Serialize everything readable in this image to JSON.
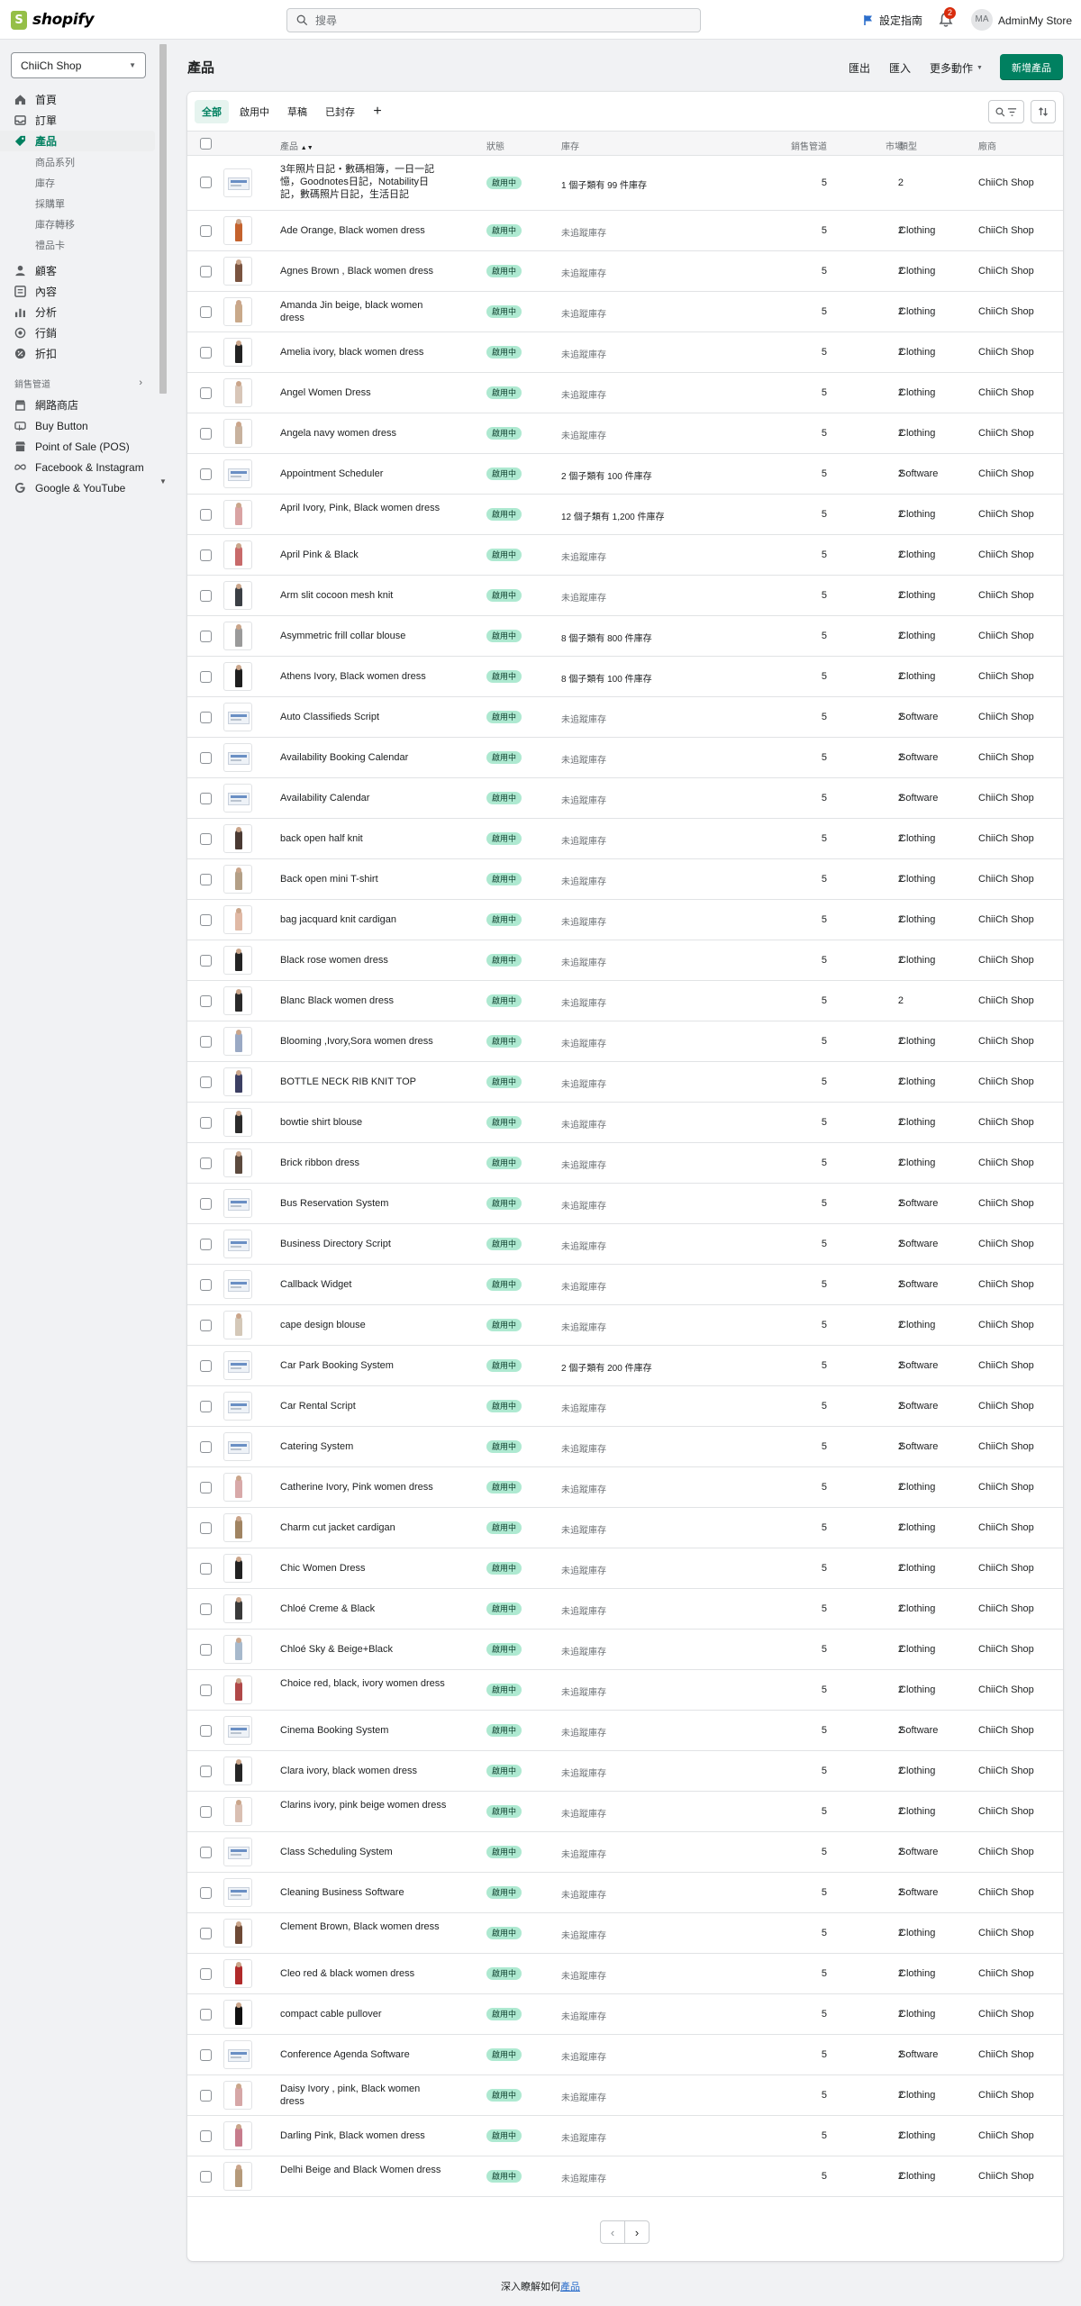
{
  "topbar": {
    "logo_text": "shopify",
    "search_placeholder": "搜尋",
    "setup_guide": "設定指南",
    "notifications_count": "2",
    "avatar_initials": "MA",
    "store_account": "AdminMy Store"
  },
  "sidebar": {
    "store_select": "ChiiCh Shop",
    "items": [
      {
        "label": "首頁",
        "icon": "home-icon"
      },
      {
        "label": "訂單",
        "icon": "orders-icon"
      },
      {
        "label": "產品",
        "icon": "tag-icon",
        "active": true
      }
    ],
    "product_subitems": [
      "商品系列",
      "庫存",
      "採購單",
      "庫存轉移",
      "禮品卡"
    ],
    "items2": [
      {
        "label": "顧客",
        "icon": "person-icon"
      },
      {
        "label": "內容",
        "icon": "content-icon"
      },
      {
        "label": "分析",
        "icon": "chart-icon"
      },
      {
        "label": "行銷",
        "icon": "target-icon"
      },
      {
        "label": "折扣",
        "icon": "discount-icon"
      }
    ],
    "channels_header": "銷售管道",
    "channels": [
      {
        "label": "網路商店",
        "icon": "store-icon"
      },
      {
        "label": "Buy Button",
        "icon": "button-icon"
      },
      {
        "label": "Point of Sale (POS)",
        "icon": "pos-icon"
      },
      {
        "label": "Facebook & Instagram",
        "icon": "meta-icon"
      },
      {
        "label": "Google & YouTube",
        "icon": "google-icon"
      }
    ]
  },
  "page": {
    "title": "產品",
    "export": "匯出",
    "import": "匯入",
    "more_actions": "更多動作",
    "add_product": "新增產品"
  },
  "tabs": [
    "全部",
    "啟用中",
    "草稿",
    "已封存"
  ],
  "table": {
    "headers": {
      "product": "產品",
      "status": "狀態",
      "inventory": "庫存",
      "sales_channels": "銷售管道",
      "markets": "市場",
      "type": "類型",
      "vendor": "廠商"
    },
    "status_label": "啟用中",
    "rows": [
      {
        "name": "3年照片日記・數碼相簿，一日一記憶，Goodnotes日記，Notability日記，數碼照片日記，生活日記",
        "inventory": "1 個子類有 99 件庫存",
        "channels": "5",
        "markets": "2",
        "type": "",
        "vendor": "ChiiCh Shop",
        "thumb": "doc",
        "lines": 3
      },
      {
        "name": "Ade Orange, Black women dress",
        "inventory": "未追蹤庫存",
        "channels": "5",
        "markets": "2",
        "type": "Clothing",
        "vendor": "ChiiCh Shop",
        "thumb": "#c4622d"
      },
      {
        "name": "Agnes Brown , Black women dress",
        "inventory": "未追蹤庫存",
        "channels": "5",
        "markets": "2",
        "type": "Clothing",
        "vendor": "ChiiCh Shop",
        "thumb": "#7a5440"
      },
      {
        "name": "Amanda Jin beige, black women dress",
        "inventory": "未追蹤庫存",
        "channels": "5",
        "markets": "2",
        "type": "Clothing",
        "vendor": "ChiiCh Shop",
        "thumb": "#c9a98a",
        "lines": 2
      },
      {
        "name": "Amelia ivory, black women dress",
        "inventory": "未追蹤庫存",
        "channels": "5",
        "markets": "2",
        "type": "Clothing",
        "vendor": "ChiiCh Shop",
        "thumb": "#222222"
      },
      {
        "name": "Angel Women Dress",
        "inventory": "未追蹤庫存",
        "channels": "5",
        "markets": "2",
        "type": "Clothing",
        "vendor": "ChiiCh Shop",
        "thumb": "#d8c6b8"
      },
      {
        "name": "Angela navy women dress",
        "inventory": "未追蹤庫存",
        "channels": "5",
        "markets": "2",
        "type": "Clothing",
        "vendor": "ChiiCh Shop",
        "thumb": "#c8b29e"
      },
      {
        "name": "Appointment Scheduler",
        "inventory": "2 個子類有 100 件庫存",
        "channels": "5",
        "markets": "2",
        "type": "Software",
        "vendor": "ChiiCh Shop",
        "thumb": "screen"
      },
      {
        "name": "April Ivory, Pink, Black women dress",
        "inventory": "12 個子類有 1,200 件庫存",
        "channels": "5",
        "markets": "2",
        "type": "Clothing",
        "vendor": "ChiiCh Shop",
        "thumb": "#d9a3a3",
        "lines": 2
      },
      {
        "name": "April Pink & Black",
        "inventory": "未追蹤庫存",
        "channels": "5",
        "markets": "2",
        "type": "Clothing",
        "vendor": "ChiiCh Shop",
        "thumb": "#c86a6a"
      },
      {
        "name": "Arm slit cocoon mesh knit",
        "inventory": "未追蹤庫存",
        "channels": "5",
        "markets": "2",
        "type": "Clothing",
        "vendor": "ChiiCh Shop",
        "thumb": "#3b3f45"
      },
      {
        "name": "Asymmetric frill collar blouse",
        "inventory": "8 個子類有 800 件庫存",
        "channels": "5",
        "markets": "2",
        "type": "Clothing",
        "vendor": "ChiiCh Shop",
        "thumb": "#9a9a9a"
      },
      {
        "name": "Athens Ivory, Black women dress",
        "inventory": "8 個子類有 100 件庫存",
        "channels": "5",
        "markets": "2",
        "type": "Clothing",
        "vendor": "ChiiCh Shop",
        "thumb": "#1f1f1f"
      },
      {
        "name": "Auto Classifieds Script",
        "inventory": "未追蹤庫存",
        "channels": "5",
        "markets": "2",
        "type": "Software",
        "vendor": "ChiiCh Shop",
        "thumb": "screen"
      },
      {
        "name": "Availability Booking Calendar",
        "inventory": "未追蹤庫存",
        "channels": "5",
        "markets": "2",
        "type": "Software",
        "vendor": "ChiiCh Shop",
        "thumb": "screen"
      },
      {
        "name": "Availability Calendar",
        "inventory": "未追蹤庫存",
        "channels": "5",
        "markets": "2",
        "type": "Software",
        "vendor": "ChiiCh Shop",
        "thumb": "screen"
      },
      {
        "name": "back open half knit",
        "inventory": "未追蹤庫存",
        "channels": "5",
        "markets": "2",
        "type": "Clothing",
        "vendor": "ChiiCh Shop",
        "thumb": "#4a3a33"
      },
      {
        "name": "Back open mini T-shirt",
        "inventory": "未追蹤庫存",
        "channels": "5",
        "markets": "2",
        "type": "Clothing",
        "vendor": "ChiiCh Shop",
        "thumb": "#b39f86"
      },
      {
        "name": "bag jacquard knit cardigan",
        "inventory": "未追蹤庫存",
        "channels": "5",
        "markets": "2",
        "type": "Clothing",
        "vendor": "ChiiCh Shop",
        "thumb": "#e0b9a5"
      },
      {
        "name": "Black rose women dress",
        "inventory": "未追蹤庫存",
        "channels": "5",
        "markets": "2",
        "type": "Clothing",
        "vendor": "ChiiCh Shop",
        "thumb": "#242424"
      },
      {
        "name": "Blanc Black women dress",
        "inventory": "未追蹤庫存",
        "channels": "5",
        "markets": "2",
        "type": "",
        "vendor": "ChiiCh Shop",
        "thumb": "#2a2a2a"
      },
      {
        "name": "Blooming ,Ivory,Sora women dress",
        "inventory": "未追蹤庫存",
        "channels": "5",
        "markets": "2",
        "type": "Clothing",
        "vendor": "ChiiCh Shop",
        "thumb": "#9aa9c4"
      },
      {
        "name": "BOTTLE NECK RIB KNIT TOP",
        "inventory": "未追蹤庫存",
        "channels": "5",
        "markets": "2",
        "type": "Clothing",
        "vendor": "ChiiCh Shop",
        "thumb": "#3c3f63"
      },
      {
        "name": "bowtie shirt blouse",
        "inventory": "未追蹤庫存",
        "channels": "5",
        "markets": "2",
        "type": "Clothing",
        "vendor": "ChiiCh Shop",
        "thumb": "#2b2b2b"
      },
      {
        "name": "Brick ribbon dress",
        "inventory": "未追蹤庫存",
        "channels": "5",
        "markets": "2",
        "type": "Clothing",
        "vendor": "ChiiCh Shop",
        "thumb": "#5c4a3e"
      },
      {
        "name": "Bus Reservation System",
        "inventory": "未追蹤庫存",
        "channels": "5",
        "markets": "2",
        "type": "Software",
        "vendor": "ChiiCh Shop",
        "thumb": "screen"
      },
      {
        "name": "Business Directory Script",
        "inventory": "未追蹤庫存",
        "channels": "5",
        "markets": "2",
        "type": "Software",
        "vendor": "ChiiCh Shop",
        "thumb": "screen"
      },
      {
        "name": "Callback Widget",
        "inventory": "未追蹤庫存",
        "channels": "5",
        "markets": "2",
        "type": "Software",
        "vendor": "ChiiCh Shop",
        "thumb": "screen"
      },
      {
        "name": "cape design blouse",
        "inventory": "未追蹤庫存",
        "channels": "5",
        "markets": "2",
        "type": "Clothing",
        "vendor": "ChiiCh Shop",
        "thumb": "#d4c8b8"
      },
      {
        "name": "Car Park Booking System",
        "inventory": "2 個子類有 200 件庫存",
        "channels": "5",
        "markets": "2",
        "type": "Software",
        "vendor": "ChiiCh Shop",
        "thumb": "screen"
      },
      {
        "name": "Car Rental Script",
        "inventory": "未追蹤庫存",
        "channels": "5",
        "markets": "2",
        "type": "Software",
        "vendor": "ChiiCh Shop",
        "thumb": "screen"
      },
      {
        "name": "Catering System",
        "inventory": "未追蹤庫存",
        "channels": "5",
        "markets": "2",
        "type": "Software",
        "vendor": "ChiiCh Shop",
        "thumb": "screen"
      },
      {
        "name": "Catherine Ivory, Pink women dress",
        "inventory": "未追蹤庫存",
        "channels": "5",
        "markets": "2",
        "type": "Clothing",
        "vendor": "ChiiCh Shop",
        "thumb": "#d8a9a9"
      },
      {
        "name": "Charm cut jacket cardigan",
        "inventory": "未追蹤庫存",
        "channels": "5",
        "markets": "2",
        "type": "Clothing",
        "vendor": "ChiiCh Shop",
        "thumb": "#a08462"
      },
      {
        "name": "Chic Women Dress",
        "inventory": "未追蹤庫存",
        "channels": "5",
        "markets": "2",
        "type": "Clothing",
        "vendor": "ChiiCh Shop",
        "thumb": "#222222"
      },
      {
        "name": "Chloé Creme & Black",
        "inventory": "未追蹤庫存",
        "channels": "5",
        "markets": "2",
        "type": "Clothing",
        "vendor": "ChiiCh Shop",
        "thumb": "#3a3a3a"
      },
      {
        "name": "Chloé Sky & Beige+Black",
        "inventory": "未追蹤庫存",
        "channels": "5",
        "markets": "2",
        "type": "Clothing",
        "vendor": "ChiiCh Shop",
        "thumb": "#a7b9cc"
      },
      {
        "name": "Choice red, black, ivory women dress",
        "inventory": "未追蹤庫存",
        "channels": "5",
        "markets": "2",
        "type": "Clothing",
        "vendor": "ChiiCh Shop",
        "thumb": "#b04848",
        "lines": 2
      },
      {
        "name": "Cinema Booking System",
        "inventory": "未追蹤庫存",
        "channels": "5",
        "markets": "2",
        "type": "Software",
        "vendor": "ChiiCh Shop",
        "thumb": "screen"
      },
      {
        "name": "Clara ivory, black women dress",
        "inventory": "未追蹤庫存",
        "channels": "5",
        "markets": "2",
        "type": "Clothing",
        "vendor": "ChiiCh Shop",
        "thumb": "#262626"
      },
      {
        "name": "Clarins ivory, pink beige women dress",
        "inventory": "未追蹤庫存",
        "channels": "5",
        "markets": "2",
        "type": "Clothing",
        "vendor": "ChiiCh Shop",
        "thumb": "#d9bfb2",
        "lines": 2
      },
      {
        "name": "Class Scheduling System",
        "inventory": "未追蹤庫存",
        "channels": "5",
        "markets": "2",
        "type": "Software",
        "vendor": "ChiiCh Shop",
        "thumb": "screen"
      },
      {
        "name": "Cleaning Business Software",
        "inventory": "未追蹤庫存",
        "channels": "5",
        "markets": "2",
        "type": "Software",
        "vendor": "ChiiCh Shop",
        "thumb": "screen"
      },
      {
        "name": "Clement Brown, Black women dress",
        "inventory": "未追蹤庫存",
        "channels": "5",
        "markets": "2",
        "type": "Clothing",
        "vendor": "ChiiCh Shop",
        "thumb": "#6e4a36",
        "lines": 2
      },
      {
        "name": "Cleo red & black women dress",
        "inventory": "未追蹤庫存",
        "channels": "5",
        "markets": "2",
        "type": "Clothing",
        "vendor": "ChiiCh Shop",
        "thumb": "#b02a2a"
      },
      {
        "name": "compact cable pullover",
        "inventory": "未追蹤庫存",
        "channels": "5",
        "markets": "2",
        "type": "Clothing",
        "vendor": "ChiiCh Shop",
        "thumb": "#111111"
      },
      {
        "name": "Conference Agenda Software",
        "inventory": "未追蹤庫存",
        "channels": "5",
        "markets": "2",
        "type": "Software",
        "vendor": "ChiiCh Shop",
        "thumb": "screen"
      },
      {
        "name": "Daisy Ivory , pink, Black women dress",
        "inventory": "未追蹤庫存",
        "channels": "5",
        "markets": "2",
        "type": "Clothing",
        "vendor": "ChiiCh Shop",
        "thumb": "#d6a7a7",
        "lines": 2
      },
      {
        "name": "Darling Pink, Black women dress",
        "inventory": "未追蹤庫存",
        "channels": "5",
        "markets": "2",
        "type": "Clothing",
        "vendor": "ChiiCh Shop",
        "thumb": "#c77c8c"
      },
      {
        "name": "Delhi Beige and Black Women dress",
        "inventory": "未追蹤庫存",
        "channels": "5",
        "markets": "2",
        "type": "Clothing",
        "vendor": "ChiiCh Shop",
        "thumb": "#b59a7a",
        "lines": 2
      }
    ]
  },
  "footer": {
    "text": "深入瞭解如何",
    "link": "產品"
  },
  "colors": {
    "brand": "#008060",
    "badge_bg": "#aee9d1",
    "logo": "#95bf47"
  }
}
